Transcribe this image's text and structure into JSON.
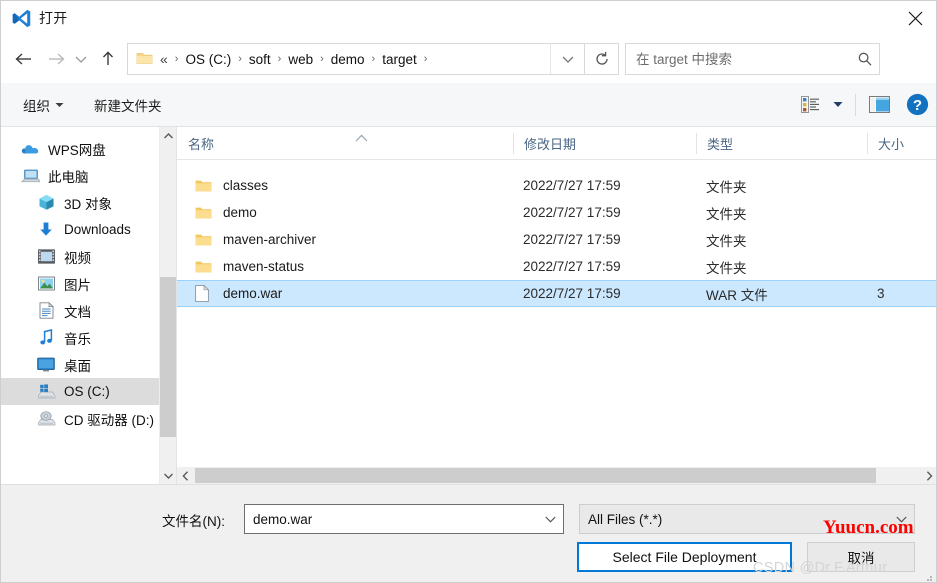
{
  "window": {
    "title": "打开",
    "title_icon": "vscode-logo-icon",
    "close_label": "✕"
  },
  "nav": {
    "back": "back-arrow-icon",
    "forward": "forward-arrow-icon",
    "recent": "recent-locations-chevron-icon",
    "up": "up-arrow-icon",
    "refresh": "refresh-icon",
    "dropdown": "address-dropdown-icon"
  },
  "address": {
    "lead": "«",
    "crumbs": [
      "OS (C:)",
      "soft",
      "web",
      "demo",
      "target"
    ],
    "separator": "›"
  },
  "search": {
    "placeholder": "在 target 中搜索",
    "icon": "search-icon"
  },
  "toolbar": {
    "organize": "组织",
    "new_folder": "新建文件夹",
    "view_icon": "view-options-icon",
    "view_caret": "chevron-down-icon",
    "preview_icon": "preview-pane-icon",
    "help_icon": "help-icon"
  },
  "sidebar": {
    "items": [
      {
        "label": "WPS网盘",
        "icon": "cloud-icon",
        "depth": 0,
        "selected": false
      },
      {
        "label": "此电脑",
        "icon": "this-pc-icon",
        "depth": 0,
        "selected": false
      },
      {
        "label": "3D 对象",
        "icon": "3d-objects-icon",
        "depth": 1,
        "selected": false
      },
      {
        "label": "Downloads",
        "icon": "downloads-icon",
        "depth": 1,
        "selected": false
      },
      {
        "label": "视频",
        "icon": "videos-icon",
        "depth": 1,
        "selected": false
      },
      {
        "label": "图片",
        "icon": "pictures-icon",
        "depth": 1,
        "selected": false
      },
      {
        "label": "文档",
        "icon": "documents-icon",
        "depth": 1,
        "selected": false
      },
      {
        "label": "音乐",
        "icon": "music-icon",
        "depth": 1,
        "selected": false
      },
      {
        "label": "桌面",
        "icon": "desktop-icon",
        "depth": 1,
        "selected": false
      },
      {
        "label": "OS (C:)",
        "icon": "windows-drive-icon",
        "depth": 1,
        "selected": true
      },
      {
        "label": "CD 驱动器 (D:)",
        "icon": "cd-drive-icon",
        "depth": 1,
        "selected": false
      }
    ]
  },
  "filelist": {
    "columns": [
      {
        "label": "名称",
        "key": "name"
      },
      {
        "label": "修改日期",
        "key": "date"
      },
      {
        "label": "类型",
        "key": "type"
      },
      {
        "label": "大小",
        "key": "size"
      }
    ],
    "sort_indicator": "sort-ascending-caret-icon",
    "rows": [
      {
        "name": "classes",
        "date": "2022/7/27 17:59",
        "type": "文件夹",
        "size": "",
        "icon": "folder-icon",
        "selected": false
      },
      {
        "name": "demo",
        "date": "2022/7/27 17:59",
        "type": "文件夹",
        "size": "",
        "icon": "folder-icon",
        "selected": false
      },
      {
        "name": "maven-archiver",
        "date": "2022/7/27 17:59",
        "type": "文件夹",
        "size": "",
        "icon": "folder-icon",
        "selected": false
      },
      {
        "name": "maven-status",
        "date": "2022/7/27 17:59",
        "type": "文件夹",
        "size": "",
        "icon": "folder-icon",
        "selected": false
      },
      {
        "name": "demo.war",
        "date": "2022/7/27 17:59",
        "type": "WAR 文件",
        "size": "3",
        "icon": "file-icon",
        "selected": true
      }
    ]
  },
  "bottom": {
    "filename_label": "文件名(N):",
    "filename_value": "demo.war",
    "filter_value": "All Files (*.*)",
    "open_button": "Select File Deployment",
    "cancel_button": "取消"
  },
  "watermarks": {
    "primary": "Yuucn.com",
    "secondary": "CSDN @Dr.F.Arthur"
  },
  "colors": {
    "accent": "#0078d7",
    "selection": "#cce8ff",
    "header_text": "#4a6585",
    "watermark_red": "#ff0000"
  }
}
